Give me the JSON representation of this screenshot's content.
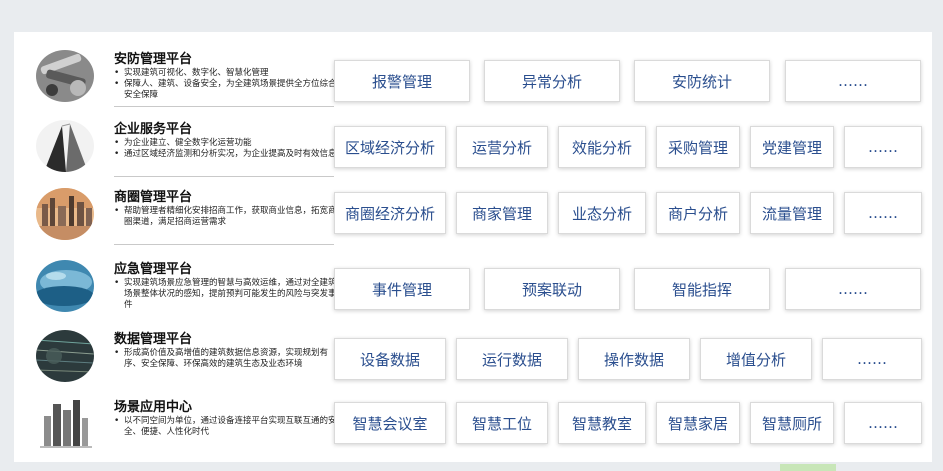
{
  "platforms": [
    {
      "title": "安防管理平台",
      "bullets": [
        "实现建筑可视化、数字化、智慧化管理",
        "保障人、建筑、设备安全，为全建筑场景提供全方位综合安全保障"
      ],
      "tags": [
        "报警管理",
        "异常分析",
        "安防统计",
        "……"
      ]
    },
    {
      "title": "企业服务平台",
      "bullets": [
        "为企业建立、健全数字化运营功能",
        "通过区域经济监测和分析实况，为企业提高及时有效信息"
      ],
      "tags": [
        "区域经济分析",
        "运营分析",
        "效能分析",
        "采购管理",
        "党建管理",
        "……"
      ]
    },
    {
      "title": "商圈管理平台",
      "bullets": [
        "帮助管理者精细化安排招商工作，获取商业信息，拓宽商圈渠道，满足招商运营需求"
      ],
      "tags": [
        "商圈经济分析",
        "商家管理",
        "业态分析",
        "商户分析",
        "流量管理",
        "……"
      ]
    },
    {
      "title": "应急管理平台",
      "bullets": [
        "实现建筑场景应急管理的智慧与高效运维，通过对全建筑场景整体状况的感知，提前预判可能发生的风险与突发事件"
      ],
      "tags": [
        "事件管理",
        "预案联动",
        "智能指挥",
        "……"
      ]
    },
    {
      "title": "数据管理平台",
      "bullets": [
        "形成高价值及高增值的建筑数据信息资源，实现规划有序、安全保障、环保高效的建筑生态及业态环境"
      ],
      "tags": [
        "设备数据",
        "运行数据",
        "操作数据",
        "增值分析",
        "……"
      ]
    },
    {
      "title": "场景应用中心",
      "bullets": [
        "以不同空间为单位，通过设备连接平台实现互联互通的安全、便捷、人性化时代"
      ],
      "tags": [
        "智慧会议室",
        "智慧工位",
        "智慧教室",
        "智慧家居",
        "智慧厕所",
        "……"
      ]
    }
  ]
}
